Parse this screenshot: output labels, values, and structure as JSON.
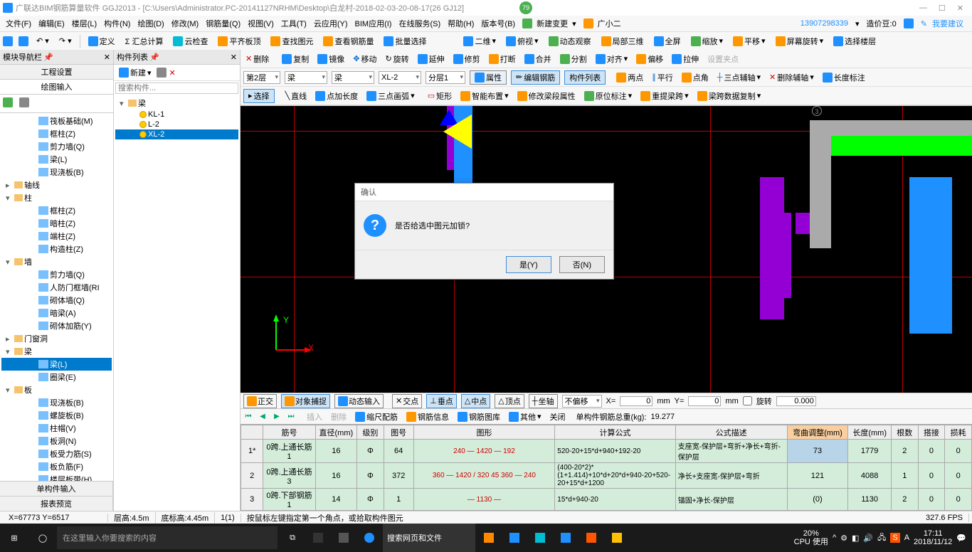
{
  "title": "广联达BIM钢筋算量软件 GGJ2013 - [C:\\Users\\Administrator.PC-20141127NRHM\\Desktop\\白龙村-2018-02-03-20-08-17(26        GJ12]",
  "badge": "79",
  "window_buttons": {
    "min": "—",
    "max": "☐",
    "close": "✕"
  },
  "menubar": [
    "文件(F)",
    "编辑(E)",
    "楼层(L)",
    "构件(N)",
    "绘图(D)",
    "修改(M)",
    "钢筋量(Q)",
    "视图(V)",
    "工具(T)",
    "云应用(Y)",
    "BIM应用(I)",
    "在线服务(S)",
    "帮助(H)",
    "版本号(B)"
  ],
  "menu_right": {
    "new_change": "新建变更",
    "agent": "广小二",
    "phone": "13907298339",
    "cost": "造价豆:0",
    "suggest": "我要建议"
  },
  "toolbar1": [
    "定义",
    "Σ 汇总计算",
    "云检查",
    "平齐板顶",
    "查找图元",
    "查看钢筋量",
    "批量选择"
  ],
  "toolbar1b": [
    "二维",
    "俯视",
    "动态观察",
    "局部三维",
    "全屏",
    "缩放",
    "平移",
    "屏幕旋转",
    "选择楼层"
  ],
  "left": {
    "title": "模块导航栏",
    "tab1": "工程设置",
    "tab2": "绘图输入",
    "tree": [
      {
        "t": "筏板基础(M)",
        "l": 3,
        "i": "n"
      },
      {
        "t": "框柱(Z)",
        "l": 3,
        "i": "n"
      },
      {
        "t": "剪力墙(Q)",
        "l": 3,
        "i": "n"
      },
      {
        "t": "梁(L)",
        "l": 3,
        "i": "n"
      },
      {
        "t": "现浇板(B)",
        "l": 3,
        "i": "n"
      },
      {
        "t": "轴线",
        "l": 1,
        "i": "f",
        "a": "▸"
      },
      {
        "t": "柱",
        "l": 1,
        "i": "f",
        "a": "▾"
      },
      {
        "t": "框柱(Z)",
        "l": 3,
        "i": "n"
      },
      {
        "t": "暗柱(Z)",
        "l": 3,
        "i": "n"
      },
      {
        "t": "端柱(Z)",
        "l": 3,
        "i": "n"
      },
      {
        "t": "构造柱(Z)",
        "l": 3,
        "i": "n"
      },
      {
        "t": "墙",
        "l": 1,
        "i": "f",
        "a": "▾"
      },
      {
        "t": "剪力墙(Q)",
        "l": 3,
        "i": "n"
      },
      {
        "t": "人防门框墙(RI",
        "l": 3,
        "i": "n"
      },
      {
        "t": "砌体墙(Q)",
        "l": 3,
        "i": "n"
      },
      {
        "t": "暗梁(A)",
        "l": 3,
        "i": "n"
      },
      {
        "t": "砌体加筋(Y)",
        "l": 3,
        "i": "n"
      },
      {
        "t": "门窗洞",
        "l": 1,
        "i": "f",
        "a": "▸"
      },
      {
        "t": "梁",
        "l": 1,
        "i": "f",
        "a": "▾"
      },
      {
        "t": "梁(L)",
        "l": 3,
        "i": "n",
        "sel": true
      },
      {
        "t": "圈梁(E)",
        "l": 3,
        "i": "n"
      },
      {
        "t": "板",
        "l": 1,
        "i": "f",
        "a": "▾"
      },
      {
        "t": "现浇板(B)",
        "l": 3,
        "i": "n"
      },
      {
        "t": "螺旋板(B)",
        "l": 3,
        "i": "n"
      },
      {
        "t": "柱帽(V)",
        "l": 3,
        "i": "n"
      },
      {
        "t": "板洞(N)",
        "l": 3,
        "i": "n"
      },
      {
        "t": "板受力筋(S)",
        "l": 3,
        "i": "n"
      },
      {
        "t": "板负筋(F)",
        "l": 3,
        "i": "n"
      },
      {
        "t": "楼层板带(H)",
        "l": 3,
        "i": "n"
      }
    ],
    "foot1": "单构件输入",
    "foot2": "报表预览"
  },
  "mid": {
    "title": "构件列表",
    "new_btn": "新建",
    "search_ph": "搜索构件...",
    "tree": [
      {
        "t": "梁",
        "l": 1,
        "i": "f",
        "a": "▾"
      },
      {
        "t": "KL-1",
        "l": 2,
        "i": "b"
      },
      {
        "t": "L-2",
        "l": 2,
        "i": "b"
      },
      {
        "t": "XL-2",
        "l": 2,
        "i": "b",
        "sel": true
      }
    ]
  },
  "ribbon": {
    "row1": [
      "删除",
      "复制",
      "镜像",
      "移动",
      "旋转",
      "延伸",
      "修剪",
      "打断",
      "合并",
      "分割",
      "对齐",
      "偏移",
      "拉伸",
      "设置夹点"
    ],
    "row2": {
      "floor": "第2层",
      "cat1": "梁",
      "cat2": "梁",
      "comp": "XL-2",
      "subfloor": "分层1",
      "props": "属性",
      "edit": "编辑钢筋",
      "list": "构件列表",
      "two_pt": "两点",
      "parallel": "平行",
      "pt_angle": "点角",
      "three_aux": "三点辅轴",
      "del_aux": "删除辅轴",
      "len_mark": "长度标注"
    },
    "row3": {
      "select": "选择",
      "line": "直线",
      "pt_len": "点加长度",
      "arc3": "三点画弧",
      "rect": "矩形",
      "smart": "智能布置",
      "mod_span": "修改梁段属性",
      "orig_mark": "原位标注",
      "reset_span": "重提梁跨",
      "copy_span": "梁跨数据复制"
    }
  },
  "dialog": {
    "title": "确认",
    "msg": "是否给选中图元加锁?",
    "yes": "是(Y)",
    "no": "否(N)"
  },
  "coord": {
    "ortho": "正交",
    "snap": "对象捕捉",
    "dyn": "动态输入",
    "cross": "交点",
    "mid": "中点",
    "perp": "垂点",
    "vertex": "顶点",
    "axis": "坐轴",
    "offset": "不偏移",
    "x": "0",
    "y": "0",
    "rot": "旋转",
    "rotval": "0.000"
  },
  "subtb": {
    "insert": "插入",
    "delete": "删除",
    "scale": "缩尺配筋",
    "info": "钢筋信息",
    "lib": "钢筋图库",
    "other": "其他",
    "close": "关闭",
    "total_label": "单构件钢筋总重(kg):",
    "total": "19.277"
  },
  "grid": {
    "headers": [
      "",
      "筋号",
      "直径(mm)",
      "级别",
      "图号",
      "图形",
      "计算公式",
      "公式描述",
      "弯曲调整(mm)",
      "长度(mm)",
      "根数",
      "搭接",
      "损耗"
    ],
    "rows": [
      {
        "n": "1*",
        "name": "0跨.上通长筋1",
        "d": "16",
        "lv": "Φ",
        "tn": "64",
        "shape": "240 — 1420 — 192",
        "formula": "520-20+15*d+940+192-20",
        "desc": "支座宽-保护层+弯折+净长+弯折-保护层",
        "bend": "73",
        "len": "1779",
        "cnt": "2",
        "lap": "0",
        "loss": "0",
        "sel": true
      },
      {
        "n": "2",
        "name": "0跨.上通长筋3",
        "d": "16",
        "lv": "Φ",
        "tn": "372",
        "shape": "360 — 1420 / 320 45 360 — 240",
        "formula": "(400-20*2)*(1+1.414)+10*d+20*d+940-20+520-20+15*d+1200",
        "desc": "净长+支座宽-保护层+弯折",
        "bend": "121",
        "len": "4088",
        "cnt": "1",
        "lap": "0",
        "loss": "0"
      },
      {
        "n": "3",
        "name": "0跨.下部钢筋1",
        "d": "14",
        "lv": "Φ",
        "tn": "1",
        "shape": "— 1130 —",
        "formula": "15*d+940-20",
        "desc": "锚固+净长-保护层",
        "bend": "(0)",
        "len": "1130",
        "cnt": "2",
        "lap": "0",
        "loss": "0"
      }
    ]
  },
  "status": {
    "xy": "X=67773 Y=6517",
    "floor": "层高:4.5m",
    "btm": "底标高:4.45m",
    "sel": "1(1)",
    "hint": "按鼠标左键指定第一个角点，或拾取构件图元",
    "fps": "327.6 FPS"
  },
  "taskbar": {
    "search": "在这里输入你要搜索的内容",
    "browser": "搜索网页和文件",
    "cpu": "20%",
    "cpu2": "CPU 使用",
    "time": "17:11",
    "date": "2018/11/12"
  }
}
